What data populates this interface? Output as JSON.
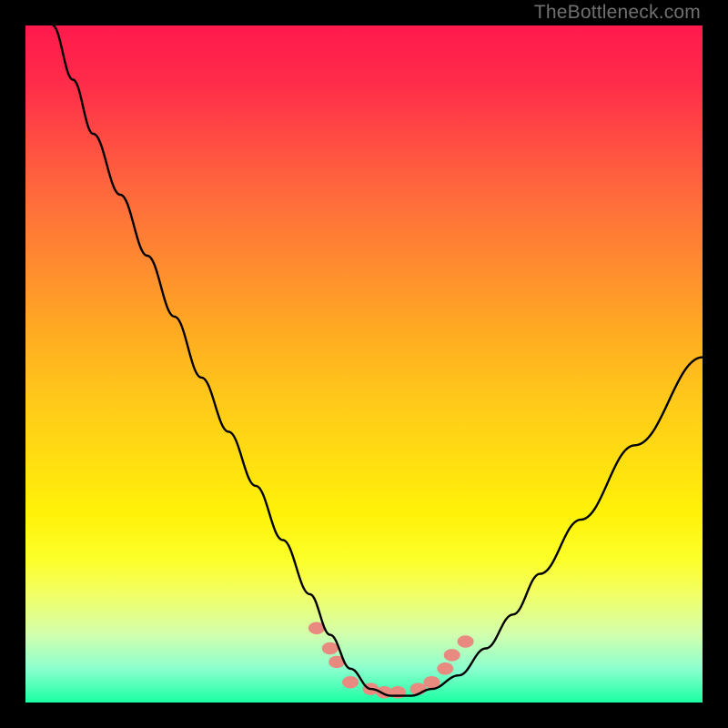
{
  "attribution": "TheBottleneck.com",
  "chart_data": {
    "type": "line",
    "title": "",
    "xlabel": "",
    "ylabel": "",
    "xlim": [
      0,
      100
    ],
    "ylim": [
      0,
      100
    ],
    "grid": false,
    "legend_position": "none",
    "background_gradient_stops": [
      {
        "pos": 0,
        "color": "#ff1a4d"
      },
      {
        "pos": 25,
        "color": "#ff6a3c"
      },
      {
        "pos": 50,
        "color": "#ffbf1e"
      },
      {
        "pos": 75,
        "color": "#fff814"
      },
      {
        "pos": 100,
        "color": "#19ffa3"
      }
    ],
    "series": [
      {
        "name": "bottleneck-curve",
        "color": "#000000",
        "x": [
          4,
          7,
          10,
          14,
          18,
          22,
          26,
          30,
          34,
          38,
          42,
          45,
          48,
          51,
          54,
          57,
          60,
          64,
          68,
          72,
          76,
          82,
          90,
          100
        ],
        "y": [
          100,
          92,
          84,
          75,
          66,
          57,
          48,
          40,
          32,
          24,
          16,
          10,
          5,
          2,
          1,
          1,
          2,
          4,
          8,
          13,
          19,
          27,
          38,
          51
        ]
      }
    ],
    "markers": {
      "name": "highlight-dots",
      "color": "#e98a80",
      "radius_px": 9,
      "points": [
        {
          "x": 43,
          "y": 11
        },
        {
          "x": 45,
          "y": 8
        },
        {
          "x": 46,
          "y": 6
        },
        {
          "x": 48,
          "y": 3
        },
        {
          "x": 51,
          "y": 2
        },
        {
          "x": 53,
          "y": 1.5
        },
        {
          "x": 55,
          "y": 1.5
        },
        {
          "x": 58,
          "y": 2
        },
        {
          "x": 60,
          "y": 3
        },
        {
          "x": 62,
          "y": 5
        },
        {
          "x": 63,
          "y": 7
        },
        {
          "x": 65,
          "y": 9
        }
      ]
    }
  }
}
